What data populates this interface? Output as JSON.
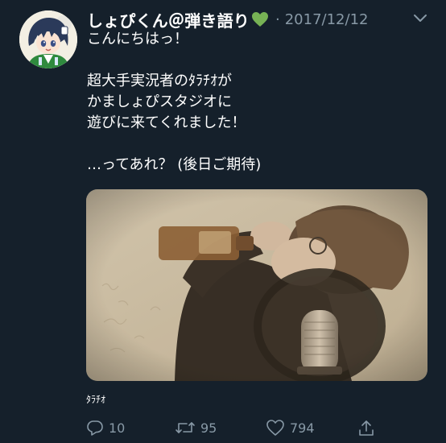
{
  "tweet": {
    "display_name": "しょぴくん＠弾き語り",
    "name_emoji": "green-heart-icon",
    "separator": "·",
    "date": "2017/12/12",
    "body_lines": [
      "こんにちはっ！",
      "",
      "超大手実況者のﾀﾗﾁｵが",
      "かましょぴスタジオに",
      "遊びに来てくれました！",
      "",
      "…ってあれ？ (後日ご期待)"
    ],
    "media_caption": "ﾀﾗﾁｵ",
    "actions": {
      "reply_count": "10",
      "retweet_count": "95",
      "like_count": "794"
    }
  },
  "colors": {
    "background": "#15202b",
    "text_primary": "#ffffff",
    "text_secondary": "#8899a6",
    "heart_green": "#77b255"
  },
  "icons": [
    "chevron-down-icon",
    "reply-icon",
    "retweet-icon",
    "like-icon",
    "share-icon"
  ]
}
